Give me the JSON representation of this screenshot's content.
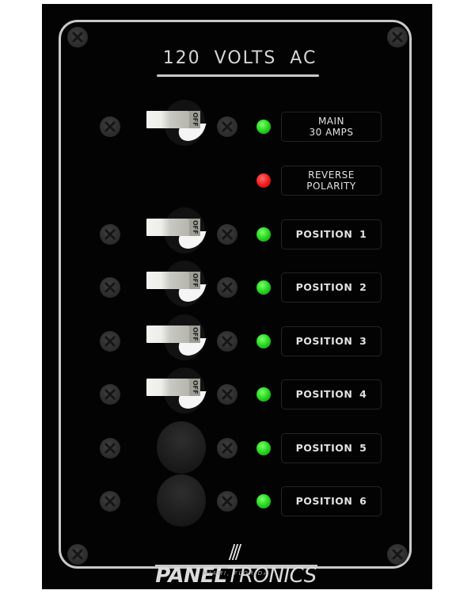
{
  "panel": {
    "title": "120  VOLTS  AC",
    "brand": {
      "name_bold": "PANEL",
      "name_light": "TRONICS",
      "location": "MIAMI,  FLORIDA"
    },
    "colors": {
      "panel_bg": "#030303",
      "border": "#c9c9c9",
      "led_green": "#1fd11a",
      "led_red": "#f01818"
    }
  },
  "rows": [
    {
      "id": "main",
      "control": "toggle-switch",
      "switch_label": "OFF",
      "led": "green",
      "label": "MAIN\n30  AMPS"
    },
    {
      "id": "reverse-polarity",
      "control": "none",
      "led": "red",
      "label": "REVERSE\nPOLARITY"
    },
    {
      "id": "position-1",
      "control": "toggle-switch",
      "switch_label": "OFF",
      "led": "green",
      "label": "POSITION  1"
    },
    {
      "id": "position-2",
      "control": "toggle-switch",
      "switch_label": "OFF",
      "led": "green",
      "label": "POSITION  2"
    },
    {
      "id": "position-3",
      "control": "toggle-switch",
      "switch_label": "OFF",
      "led": "green",
      "label": "POSITION  3"
    },
    {
      "id": "position-4",
      "control": "toggle-switch",
      "switch_label": "OFF",
      "led": "green",
      "label": "POSITION  4"
    },
    {
      "id": "position-5",
      "control": "blank-breaker",
      "led": "green",
      "label": "POSITION  5"
    },
    {
      "id": "position-6",
      "control": "blank-breaker",
      "led": "green",
      "label": "POSITION  6"
    }
  ]
}
